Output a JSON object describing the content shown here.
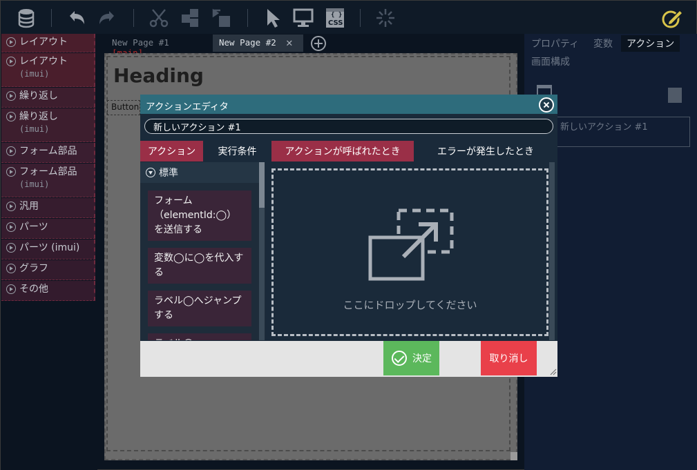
{
  "toolbar": {
    "icons": [
      "database-icon",
      "undo-icon",
      "redo-icon",
      "cut-icon",
      "copy-icon",
      "paste-icon",
      "select-icon",
      "preview-icon",
      "css-icon",
      "sparkle-icon",
      "edit-icon"
    ],
    "css_label": "{ }",
    "css_text": "CSS"
  },
  "palette": {
    "items": [
      {
        "label": "レイアウト",
        "sub": ""
      },
      {
        "label": "レイアウト",
        "sub": "(imui)"
      },
      {
        "label": "繰り返し",
        "sub": ""
      },
      {
        "label": "繰り返し",
        "sub": "(imui)"
      },
      {
        "label": "フォーム部品",
        "sub": ""
      },
      {
        "label": "フォーム部品",
        "sub": "(imui)"
      },
      {
        "label": "汎用",
        "sub": ""
      },
      {
        "label": "パーツ",
        "sub": ""
      },
      {
        "label": "パーツ (imui)",
        "sub": ""
      },
      {
        "label": "グラフ",
        "sub": ""
      },
      {
        "label": "その他",
        "sub": ""
      }
    ]
  },
  "tabs": {
    "tab1": {
      "label": "New Page #1",
      "badge": "[main]"
    },
    "tab2": {
      "label": "New Page #2"
    }
  },
  "canvas": {
    "heading": "Heading",
    "button": "Button"
  },
  "right_panel": {
    "tabs": [
      "プロパティ",
      "変数",
      "アクション"
    ],
    "sub_tab": "画面構成",
    "action_name": "新しいアクション #1"
  },
  "modal": {
    "title": "アクションエディタ",
    "name_value": "新しいアクション #1",
    "tabs": [
      "アクション",
      "実行条件",
      "アクションが呼ばれたとき",
      "エラーが発生したとき"
    ],
    "category": "標準",
    "actions": [
      "フォーム（elementId:◯）を送信する",
      "変数◯に◯を代入する",
      "ラベル◯へジャンプする",
      "ラベル◯"
    ],
    "drop_text": "ここにドロップしてください",
    "ok_label": "決定",
    "cancel_label": "取り消し"
  },
  "colors": {
    "accent": "#2e6c7c",
    "active_tab": "#9a2f47",
    "ok": "#5cb85c",
    "cancel": "#e9404a"
  }
}
